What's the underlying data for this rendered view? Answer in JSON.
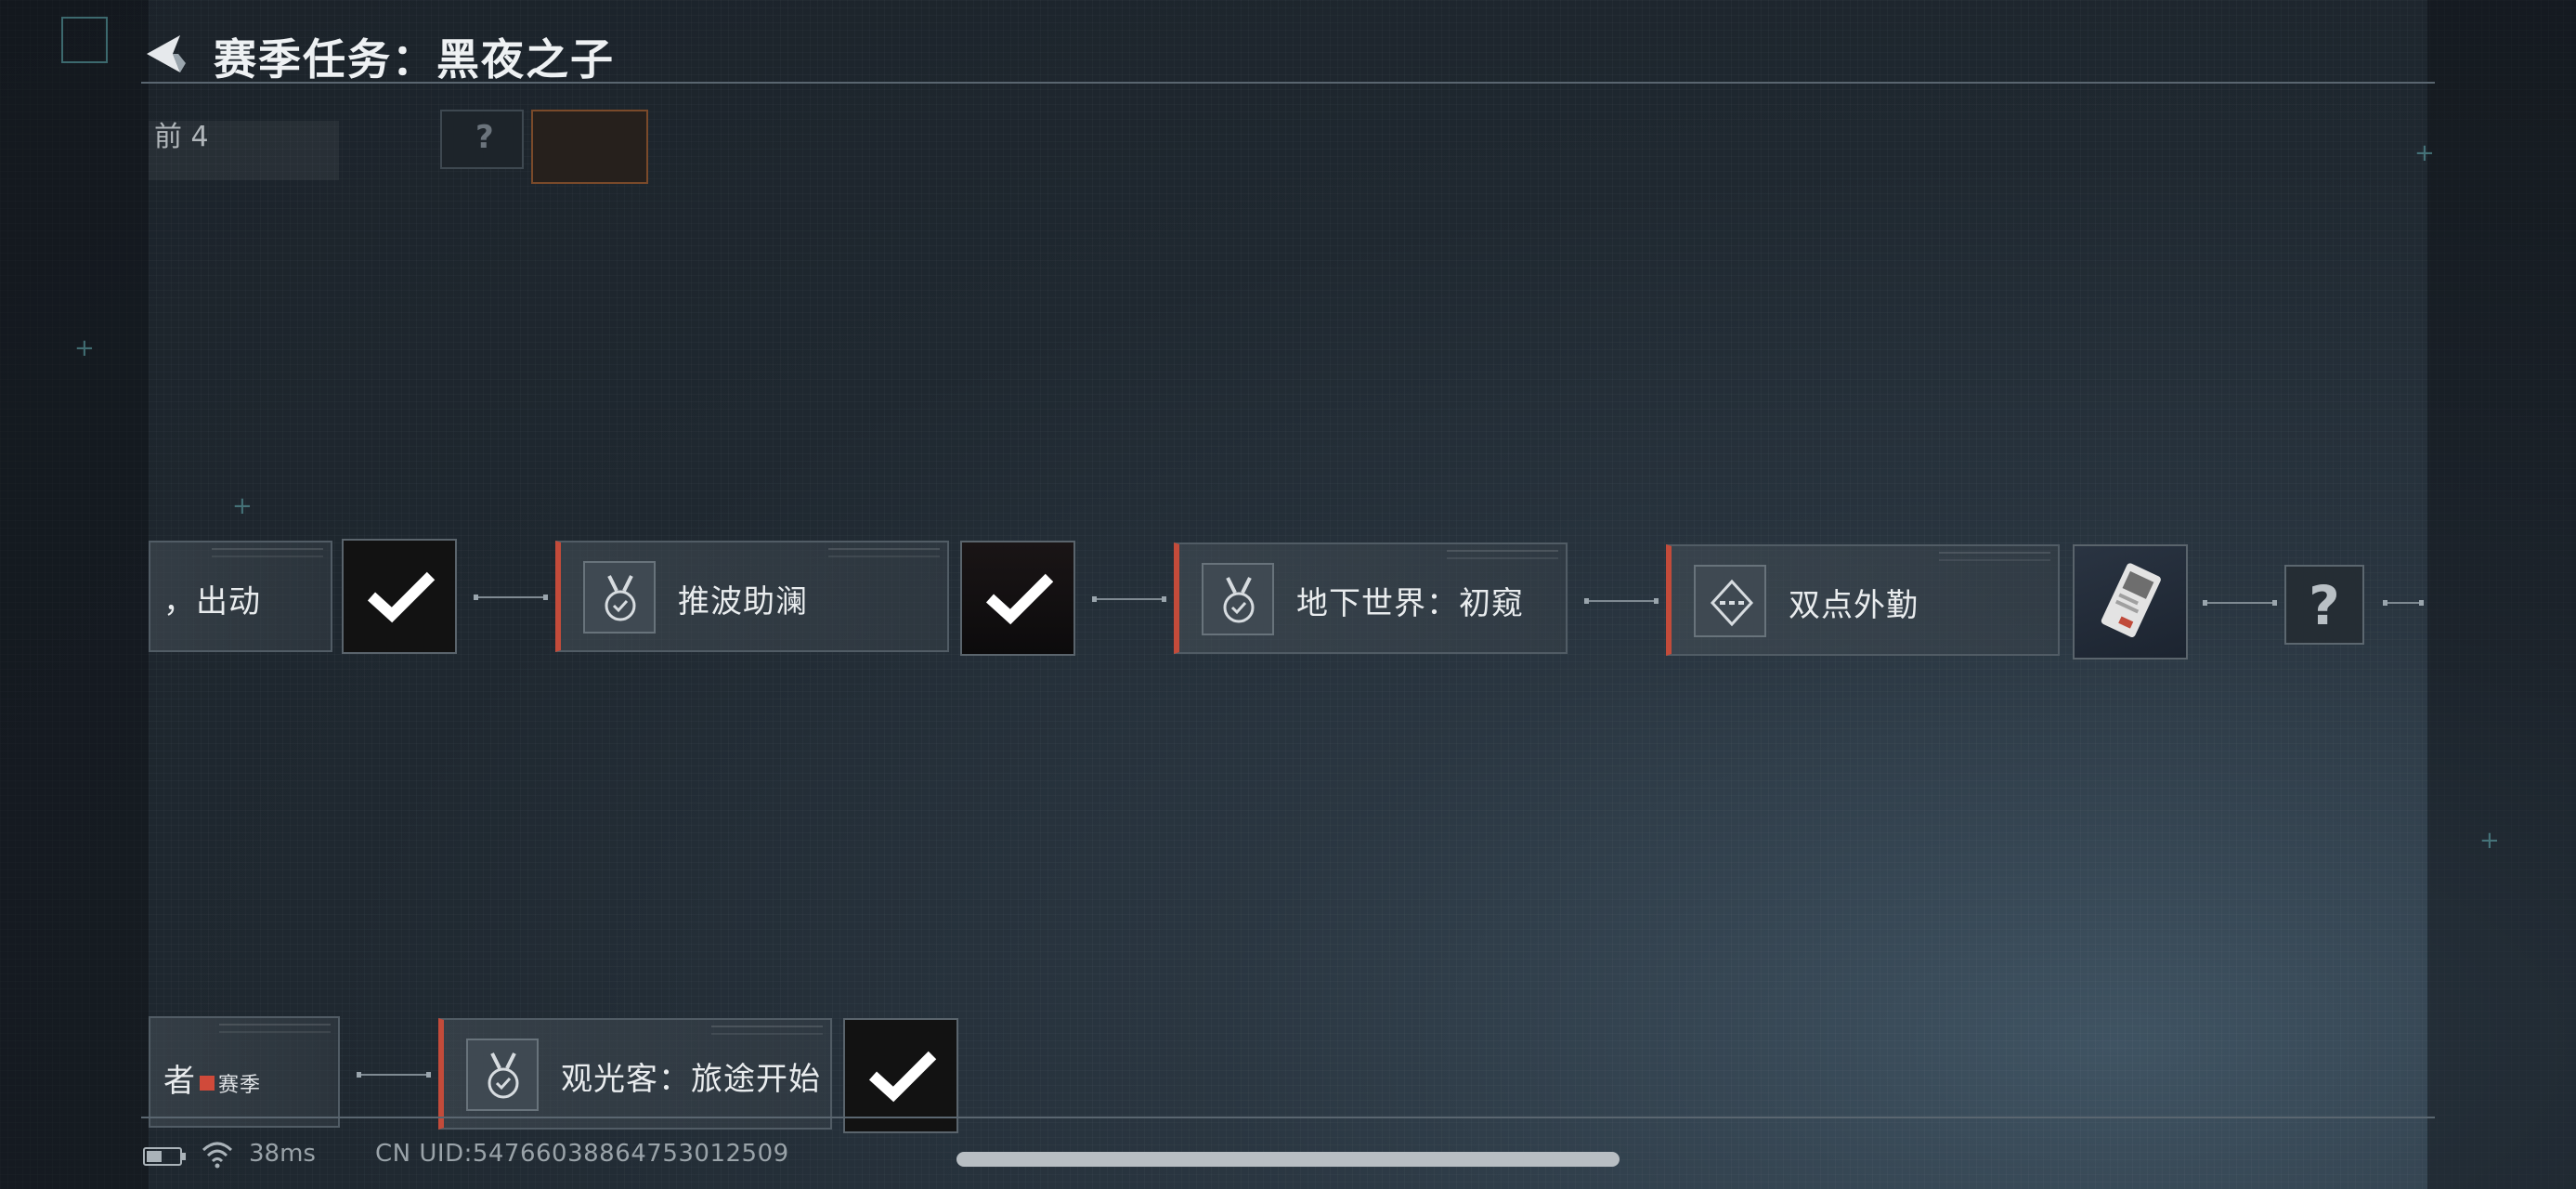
{
  "header": {
    "title": "赛季任务：黑夜之子"
  },
  "top_partial": {
    "text": "前 4",
    "icon_glyph": "?"
  },
  "tasks_row1": [
    {
      "label": "，出动",
      "state": "completed"
    },
    {
      "label": "推波助澜",
      "icon": "medal-check-icon",
      "state": "completed"
    },
    {
      "label": "地下世界：初窥",
      "icon": "medal-check-icon",
      "state": "in-progress"
    },
    {
      "label": "双点外勤",
      "icon": "diamond-dots-icon",
      "state": "in-progress"
    }
  ],
  "locked_reward": {
    "glyph": "?"
  },
  "tasks_row2": [
    {
      "label": "者",
      "badge": "赛季"
    },
    {
      "label": "观光客：旅途开始",
      "icon": "medal-check-icon",
      "state": "completed"
    }
  ],
  "footer": {
    "ping": "38ms",
    "uid": "CN UID:547660388647530125​09"
  },
  "colors": {
    "accent": "#c34b3a",
    "check": "#ffffff",
    "background": "#1f2830"
  }
}
